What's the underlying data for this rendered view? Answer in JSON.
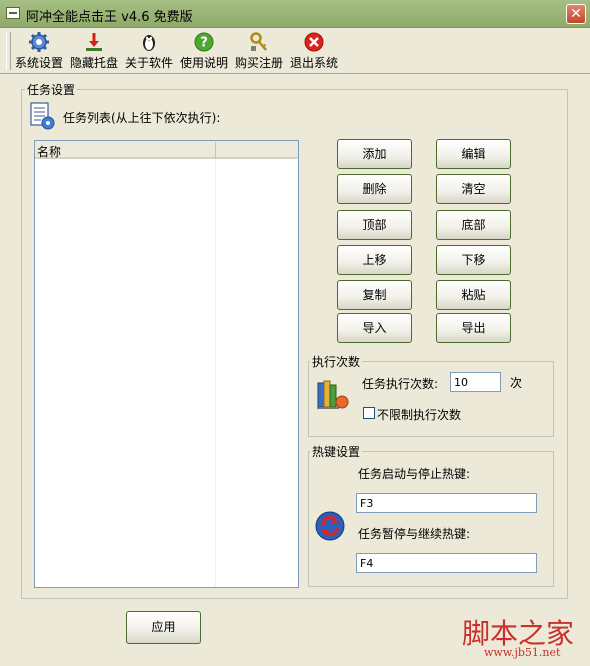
{
  "window": {
    "title": "阿冲全能点击王 v4.6 免费版",
    "close_glyph": "✕"
  },
  "toolbar": {
    "items": [
      {
        "label": "系统设置",
        "icon": "gear-icon"
      },
      {
        "label": "隐藏托盘",
        "icon": "download-arrow-icon"
      },
      {
        "label": "关于软件",
        "icon": "penguin-icon"
      },
      {
        "label": "使用说明",
        "icon": "help-icon"
      },
      {
        "label": "购买注册",
        "icon": "key-icon"
      },
      {
        "label": "退出系统",
        "icon": "exit-icon"
      }
    ]
  },
  "task_settings": {
    "group_title": "任务设置",
    "list_caption": "任务列表(从上往下依次执行):",
    "column_name": "名称",
    "rows": []
  },
  "buttons": {
    "add": "添加",
    "edit": "编辑",
    "delete": "删除",
    "clear": "清空",
    "top": "顶部",
    "bottom": "底部",
    "move_up": "上移",
    "move_down": "下移",
    "copy": "复制",
    "paste": "粘贴",
    "import": "导入",
    "export": "导出"
  },
  "exec_count": {
    "group_title": "执行次数",
    "label": "任务执行次数:",
    "value": "10",
    "unit": "次",
    "unlimited_label": "不限制执行次数",
    "unlimited_checked": false
  },
  "hotkeys": {
    "group_title": "热键设置",
    "start_stop_label": "任务启动与停止热键:",
    "start_stop_value": "F3",
    "pause_resume_label": "任务暂停与继续热键:",
    "pause_resume_value": "F4"
  },
  "apply_label": "应用",
  "watermark": {
    "brand": "脚本之家",
    "url": "www.jb51.net"
  },
  "colors": {
    "titlebar": "#A6BF83",
    "window_bg": "#ECE9D8",
    "button_border": "#4D6B2E",
    "watermark": "#C9302C"
  }
}
